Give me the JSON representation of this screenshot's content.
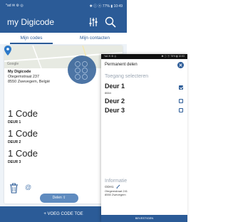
{
  "left_phone": {
    "status_bar": {
      "left": "*ad ✉ ⚙ ◎",
      "right": "✱ ⓘ ⓝ 77% ▮ 10:49"
    },
    "app_title": "my Digicode",
    "tabs": [
      {
        "label": "Mijn codes",
        "active": true
      },
      {
        "label": "Mijn contacten",
        "active": false
      }
    ],
    "card": {
      "map_logo": "Google",
      "title": "My Digicode",
      "address_line1": "Otegemstraat 237",
      "address_line2": "8550 Zwevegem, België",
      "codes": [
        {
          "name": "1 Code",
          "door": "DEUR 1"
        },
        {
          "name": "1 Code",
          "door": "DEUR 2"
        },
        {
          "name": "1 Code",
          "door": "DEUR 3"
        }
      ]
    },
    "share_button": "Delen ⇪",
    "add_code_button": "+ VOEG CODE TOE",
    "accent_color": "#2b5b97"
  },
  "right_phone": {
    "status_bar": {
      "left": "*ad ✉ ⚙ ◎",
      "right": "✱ ⓘ ⓝ 76% ▮ 10:53"
    },
    "header_title": "Permanent delen",
    "section_access": "Toegang selecteren",
    "doors": [
      {
        "name": "Deur 1",
        "code": "8664",
        "checked": true
      },
      {
        "name": "Deur 2",
        "code": "",
        "checked": false
      },
      {
        "name": "Deur 3",
        "code": "",
        "checked": false
      }
    ],
    "section_info": "Informatie",
    "info_name": "ODH1",
    "info_address1": "Otegemstraat 241",
    "info_address2": "8550 Zwevegem",
    "confirm_button": "BEVESTIGEN"
  }
}
